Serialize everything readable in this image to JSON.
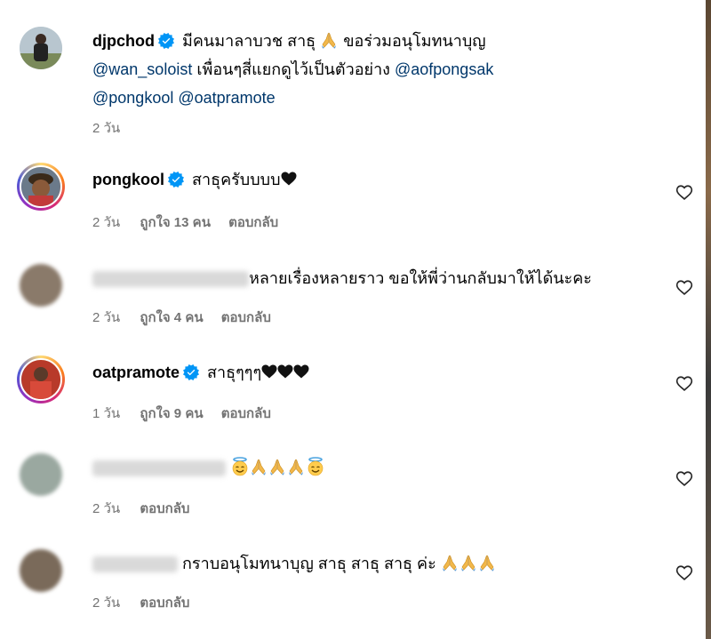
{
  "colors": {
    "link": "#00376b",
    "muted": "#737373",
    "verified": "#0095f6"
  },
  "post": {
    "username": "djpchod",
    "text_line1": "มีคนมาลาบวช สาธุ",
    "text_line1b": "ขอร่วมอนุโมทนาบุญ",
    "mention1": "@wan_soloist",
    "text_line2": "เพื่อนๆสี่แยกดูไว้เป็นตัวอย่าง",
    "mention2": "@aofpongsak",
    "mention3": "@pongkool",
    "mention4": "@oatpramote",
    "time": "2 วัน"
  },
  "comments": [
    {
      "username": "pongkool",
      "verified": true,
      "text": "สาธุครับบบบ",
      "time": "2 วัน",
      "likes": "ถูกใจ 13 คน",
      "reply": "ตอบกลับ"
    },
    {
      "username": "",
      "verified": false,
      "text": "หลายเรื่องหลายราว ขอให้พี่ว่านกลับมาให้ได้นะคะ",
      "time": "2 วัน",
      "likes": "ถูกใจ 4 คน",
      "reply": "ตอบกลับ"
    },
    {
      "username": "oatpramote",
      "verified": true,
      "text": "สาธุๆๆๆ",
      "time": "1 วัน",
      "likes": "ถูกใจ 9 คน",
      "reply": "ตอบกลับ"
    },
    {
      "username": "",
      "verified": false,
      "text": "",
      "time": "2 วัน",
      "likes": "",
      "reply": "ตอบกลับ"
    },
    {
      "username": "",
      "verified": false,
      "text": "กราบอนุโมทนาบุญ สาธุ สาธุ สาธุ ค่ะ",
      "time": "2 วัน",
      "likes": "",
      "reply": "ตอบกลับ"
    }
  ],
  "icons": {
    "like": "heart-outline-icon",
    "verified": "verified-badge-icon",
    "pray": "folded-hands-emoji",
    "halo": "smiling-face-with-halo-emoji",
    "black_heart": "black-heart-emoji"
  }
}
